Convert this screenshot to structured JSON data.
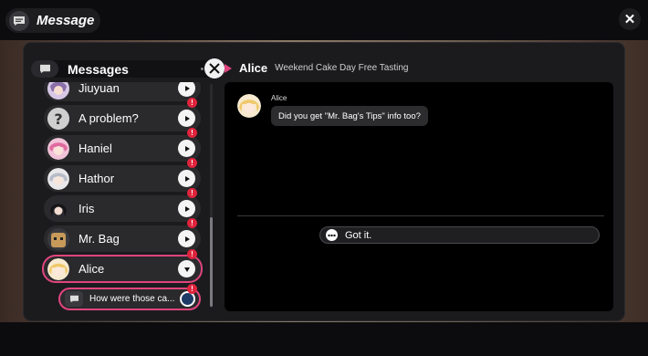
{
  "top_bar": {
    "title": "Message",
    "title_icon": "chat-bubble-icon",
    "close_icon": "close-icon",
    "close_glyph": "✕"
  },
  "sidebar": {
    "header_label": "Messages",
    "header_icon": "chat-bubble-icon",
    "header_dots": "•••",
    "header_action_icon": "crossed-swords-icon",
    "contacts": [
      {
        "name": "Jiuyuan",
        "avatar": "jiuyuan-avatar",
        "alert": false
      },
      {
        "name": "A problem?",
        "avatar": "question-mark-avatar",
        "alert": true
      },
      {
        "name": "Haniel",
        "avatar": "haniel-avatar",
        "alert": true
      },
      {
        "name": "Hathor",
        "avatar": "hathor-avatar",
        "alert": true
      },
      {
        "name": "Iris",
        "avatar": "iris-avatar",
        "alert": true
      },
      {
        "name": "Mr. Bag",
        "avatar": "mr-bag-avatar",
        "alert": true
      },
      {
        "name": "Alice",
        "avatar": "alice-avatar",
        "alert": true,
        "selected": true
      }
    ],
    "alert_glyph": "!",
    "sub_item": {
      "text": "How were those ca...",
      "icon": "chat-bubble-icon",
      "alert": true
    }
  },
  "conversation": {
    "contact_name": "Alice",
    "topic": "Weekend Cake Day Free Tasting",
    "messages": [
      {
        "sender": "Alice",
        "text": "Did you get \"Mr. Bag's Tips\" info too?"
      }
    ],
    "reply_option": "Got it.",
    "reply_icon": "ellipsis-bubble-icon"
  },
  "colors": {
    "accent": "#e0457b",
    "alert": "#e0233c",
    "panel": "#1b1b1e",
    "item": "#2a2a2d"
  }
}
